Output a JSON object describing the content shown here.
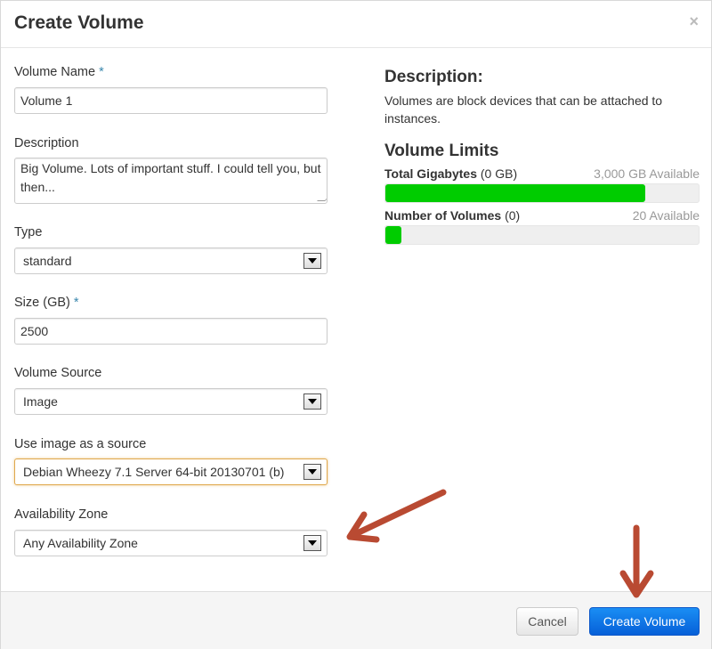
{
  "modal": {
    "title": "Create Volume",
    "close_label": "×"
  },
  "form": {
    "required_marker": "*",
    "volume_name": {
      "label": "Volume Name",
      "value": "Volume 1"
    },
    "description": {
      "label": "Description",
      "value": "Big Volume. Lots of important stuff. I could tell you, but then..."
    },
    "type": {
      "label": "Type",
      "value": "standard"
    },
    "size": {
      "label": "Size (GB)",
      "value": "2500"
    },
    "volume_source": {
      "label": "Volume Source",
      "value": "Image"
    },
    "image_source": {
      "label": "Use image as a source",
      "value": "Debian Wheezy 7.1 Server 64-bit 20130701 (b)"
    },
    "availability_zone": {
      "label": "Availability Zone",
      "value": "Any Availability Zone"
    }
  },
  "info": {
    "description_heading": "Description:",
    "description_text": "Volumes are block devices that can be attached to instances.",
    "limits_heading": "Volume Limits",
    "total_gigabytes": {
      "label": "Total Gigabytes",
      "used": "(0 GB)",
      "available": "3,000 GB Available",
      "fill_fraction": 0.83
    },
    "number_of_volumes": {
      "label": "Number of Volumes",
      "used": "(0)",
      "available": "20 Available",
      "fill_fraction": 0.05
    }
  },
  "footer": {
    "cancel_label": "Cancel",
    "create_label": "Create Volume"
  },
  "colors": {
    "progress_fill": "#00cc00",
    "primary_button": "#0a6fe0",
    "annotation_arrow": "#b94a32",
    "required_marker": "#3a87ad"
  }
}
